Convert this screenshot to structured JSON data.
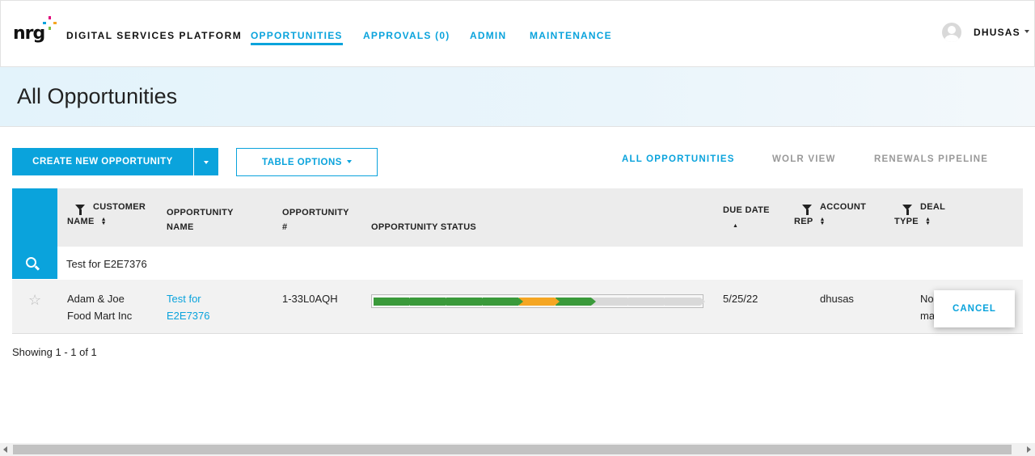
{
  "header": {
    "logo_text": "nrg",
    "brand": "DIGITAL SERVICES PLATFORM",
    "nav": [
      "OPPORTUNITIES",
      "APPROVALS (0)",
      "ADMIN",
      "MAINTENANCE"
    ],
    "active_nav": "OPPORTUNITIES",
    "username": "DHUSAS"
  },
  "page": {
    "title": "All Opportunities"
  },
  "toolbar": {
    "create_label": "CREATE NEW OPPORTUNITY",
    "table_options_label": "TABLE OPTIONS",
    "views": [
      "ALL OPPORTUNITIES",
      "WOLR VIEW",
      "RENEWALS PIPELINE"
    ],
    "active_view": "ALL OPPORTUNITIES"
  },
  "table": {
    "columns": {
      "customer": [
        "CUSTOMER",
        "NAME"
      ],
      "opp_name": [
        "OPPORTUNITY",
        "NAME"
      ],
      "opp_num": [
        "OPPORTUNITY",
        "#"
      ],
      "status": "OPPORTUNITY STATUS",
      "due": "DUE DATE",
      "account": [
        "ACCOUNT",
        "REP"
      ],
      "deal": [
        "DEAL",
        "TYPE"
      ]
    },
    "search_value": "Test for E2E7376",
    "rows": [
      {
        "customer": [
          "Adam & Joe",
          "Food Mart Inc"
        ],
        "opp_name": [
          "Test for",
          "E2E7376"
        ],
        "opp_num": "1-33L0AQH",
        "status_stages": [
          "complete",
          "complete",
          "complete",
          "complete",
          "current",
          "complete",
          "pending",
          "pending",
          "pending"
        ],
        "due_date": "5/25/22",
        "account_rep": "dhusas",
        "deal_type": [
          "No",
          "ma"
        ]
      }
    ]
  },
  "row_action": {
    "cancel_label": "CANCEL"
  },
  "footer": {
    "showing": "Showing 1 - 1 of 1"
  },
  "colors": {
    "accent": "#0aa3dc",
    "complete": "#3a9a3a",
    "current": "#f5a623",
    "pending": "#d9d9d9"
  }
}
